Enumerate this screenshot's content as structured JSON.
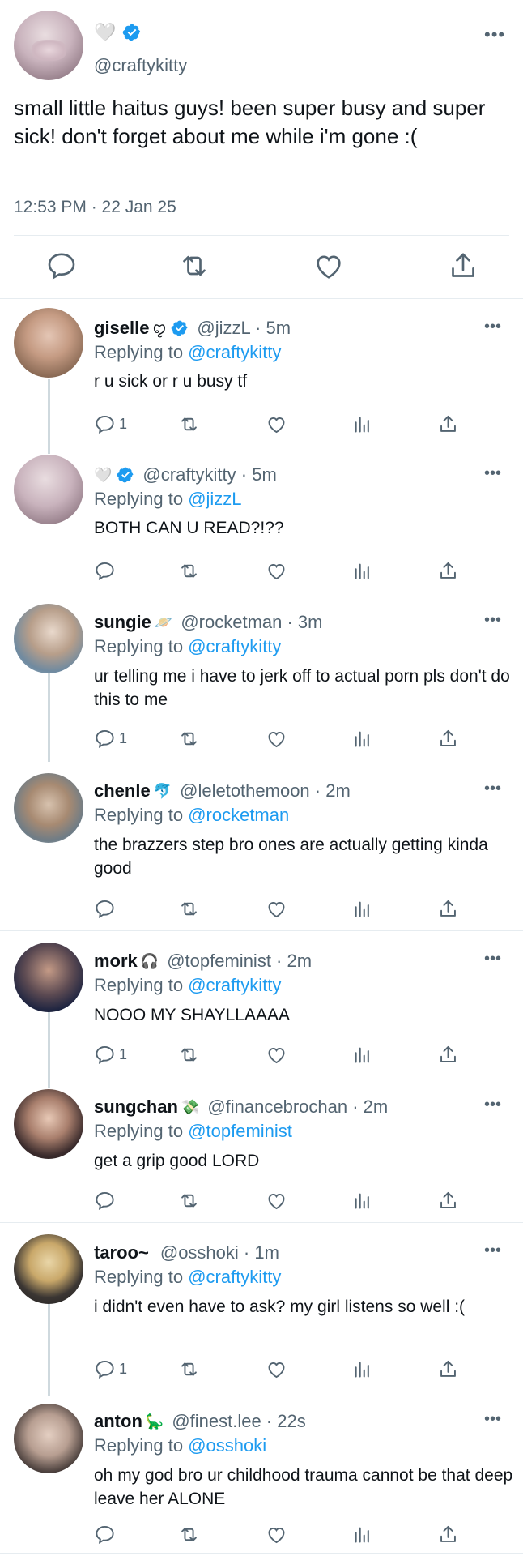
{
  "main_tweet": {
    "handle": "@craftykitty",
    "name_emoji": "🤍",
    "text": "small little haitus guys! been super busy and super sick! don't forget about me while i'm gone :(",
    "timestamp": "12:53 PM · 22 Jan 25",
    "more": "•••"
  },
  "replies": [
    {
      "name": "giselle",
      "emoji": "ꨄ",
      "verified": true,
      "handle": "@jizzL · 5m",
      "replying_prefix": "Replying to ",
      "replying_to": "@craftykitty",
      "text": "r u sick or r u busy tf",
      "reply_count": "1"
    },
    {
      "name": "",
      "emoji": "🤍",
      "verified": true,
      "handle": "@craftykitty · 5m",
      "replying_prefix": "Replying to ",
      "replying_to": "@jizzL",
      "text": "BOTH CAN U READ?!??",
      "reply_count": ""
    },
    {
      "name": "sungie",
      "emoji": "🪐",
      "verified": false,
      "handle": "@rocketman · 3m",
      "replying_prefix": "Replying to ",
      "replying_to": "@craftykitty",
      "text": "ur telling me i have to jerk off to actual porn pls don't do this to me",
      "reply_count": "1"
    },
    {
      "name": "chenle",
      "emoji": "🐬",
      "verified": false,
      "handle": "@leletothemoon · 2m",
      "replying_prefix": "Replying to ",
      "replying_to": "@rocketman",
      "text": "the brazzers step bro ones are actually getting kinda good",
      "reply_count": ""
    },
    {
      "name": "mork",
      "emoji": "🎧",
      "verified": false,
      "handle": "@topfeminist · 2m",
      "replying_prefix": "Replying to ",
      "replying_to": "@craftykitty",
      "text": "NOOO MY SHAYLLAAAA",
      "reply_count": "1"
    },
    {
      "name": "sungchan",
      "emoji": "💸",
      "verified": false,
      "handle": "@financebrochan · 2m",
      "replying_prefix": "Replying to ",
      "replying_to": "@topfeminist",
      "text": "get a grip good LORD",
      "reply_count": ""
    },
    {
      "name": "taroo~",
      "emoji": "",
      "verified": false,
      "handle": "@osshoki · 1m",
      "replying_prefix": "Replying to ",
      "replying_to": "@craftykitty",
      "text": "i didn't even have to ask? my girl listens so well :(",
      "reply_count": "1"
    },
    {
      "name": "anton",
      "emoji": "🦕",
      "verified": false,
      "handle": "@finest.lee · 22s",
      "replying_prefix": "Replying to ",
      "replying_to": "@osshoki",
      "text": "oh my god bro ur childhood trauma cannot be that deep leave her ALONE",
      "reply_count": ""
    }
  ],
  "colors": {
    "accent": "#1d9bf0",
    "text": "#0f1419",
    "secondary": "#536471",
    "divider": "#e6ecf0"
  },
  "icons": [
    "reply-icon",
    "retweet-icon",
    "like-icon",
    "views-icon",
    "share-icon",
    "verified-badge-icon",
    "more-icon"
  ]
}
